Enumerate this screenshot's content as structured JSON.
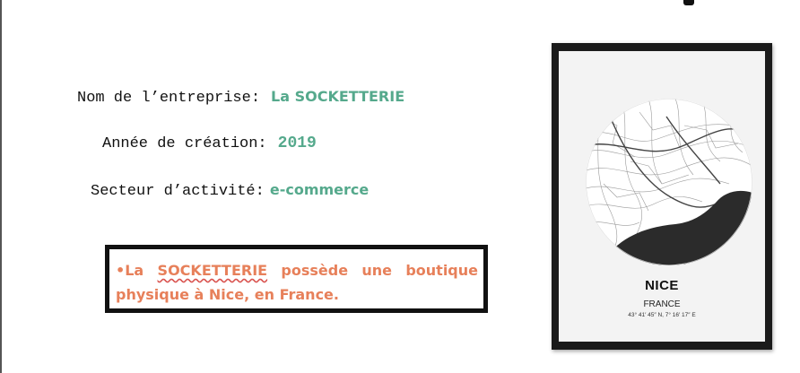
{
  "company_info": {
    "company_label": "Nom de l’entreprise:",
    "company_value": "La SOCKETTERIE",
    "year_label": "Année de création:",
    "year_value": "2019",
    "sector_label": "Secteur d’activité:",
    "sector_value": "e-commerce"
  },
  "callout": {
    "prefix": "•La ",
    "brand": "SOCKETTERIE",
    "suffix": " possède une boutique physique à Nice, en France."
  },
  "poster": {
    "city": "NICE",
    "country": "FRANCE",
    "coordinates": "43° 41′ 45″ N, 7° 16′ 17″ E"
  },
  "colors": {
    "value_teal": "#55a98c",
    "callout_orange": "#e7805a",
    "frame": "#1b1b1b",
    "sea": "#2b2b2b"
  }
}
